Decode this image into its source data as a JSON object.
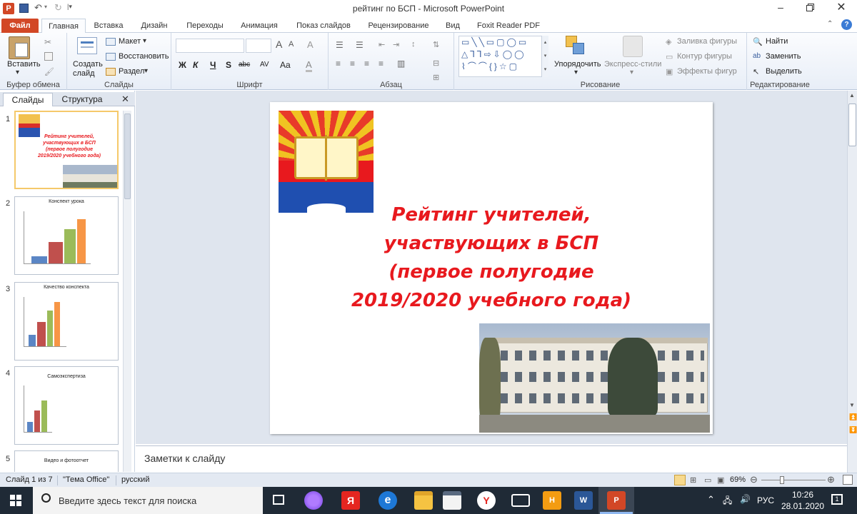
{
  "window": {
    "title": "рейтинг по БСП  -  Microsoft PowerPoint",
    "app_icon_letter": "P"
  },
  "tabs": [
    "Файл",
    "Главная",
    "Вставка",
    "Дизайн",
    "Переходы",
    "Анимация",
    "Показ слайдов",
    "Рецензирование",
    "Вид",
    "Foxit Reader PDF"
  ],
  "ribbon": {
    "clipboard": {
      "paste": "Вставить",
      "label": "Буфер обмена"
    },
    "slides": {
      "new_slide": "Создать слайд",
      "layout": "Макет",
      "reset": "Восстановить",
      "section": "Раздел",
      "label": "Слайды"
    },
    "font": {
      "bold": "Ж",
      "italic": "К",
      "underline": "Ч",
      "shadow": "S",
      "strike": "abc",
      "spacing": "AV",
      "case": "Aa",
      "grow": "A",
      "shrink": "A",
      "clear": "A",
      "color": "A",
      "label": "Шрифт"
    },
    "paragraph": {
      "label": "Абзац"
    },
    "drawing": {
      "arrange": "Упорядочить",
      "quick_styles": "Экспресс-стили",
      "fill": "Заливка фигуры",
      "outline": "Контур фигуры",
      "effects": "Эффекты фигур",
      "label": "Рисование"
    },
    "editing": {
      "find": "Найти",
      "replace": "Заменить",
      "select": "Выделить",
      "label": "Редактирование"
    }
  },
  "pane_tabs": [
    "Слайды",
    "Структура"
  ],
  "thumbs": [
    {
      "num": "1",
      "text": "Рейтинг  учителей,\nучаствующих  в БСП\n(первое полугодие\n2019/2020  учебного  года)"
    },
    {
      "num": "2",
      "title": "Конспект  урока"
    },
    {
      "num": "3",
      "title": "Качество  конспекта"
    },
    {
      "num": "4",
      "title": "Самоэкспертиза"
    },
    {
      "num": "5",
      "title": "Видео и фотоотчет"
    }
  ],
  "slide": {
    "title_lines": [
      "Рейтинг учителей,",
      "участвующих в БСП",
      "(первое полугодие",
      "2019/2020 учебного года)"
    ],
    "title_color": "#e8191e"
  },
  "notes_placeholder": "Заметки к слайду",
  "status": {
    "slide": "Слайд 1 из 7",
    "theme": "\"Тема Office\"",
    "lang": "русский",
    "zoom": "69%"
  },
  "taskbar": {
    "search": "Введите здесь текст для поиска",
    "lang": "РУС",
    "time": "10:26",
    "date": "28.01.2020"
  }
}
